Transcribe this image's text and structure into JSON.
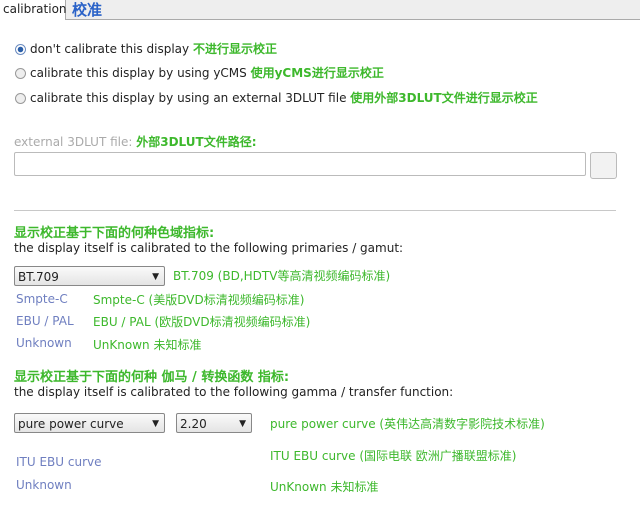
{
  "tab": {
    "label": "calibration",
    "label_cn": "校准"
  },
  "radios": [
    {
      "label": "don't calibrate this display",
      "cn": "不进行显示校正",
      "selected": true
    },
    {
      "label": "calibrate this display by using yCMS",
      "cn": "使用yCMS进行显示校正",
      "selected": false
    },
    {
      "label": "calibrate this display by using an external 3DLUT file",
      "cn": "使用外部3DLUT文件进行显示校正",
      "selected": false
    }
  ],
  "file": {
    "label": "external 3DLUT file:",
    "cn": "外部3DLUT文件路径:",
    "value": ""
  },
  "gamut": {
    "heading_cn": "显示校正基于下面的何种色域指标:",
    "desc": "the display itself is calibrated to the following primaries / gamut:",
    "selected": "BT.709",
    "selected_note": "BT.709 (BD,HDTV等高清视频编码标准)",
    "options": [
      {
        "label": "Smpte-C",
        "note": "Smpte-C (美版DVD标清视频编码标准)"
      },
      {
        "label": "EBU / PAL",
        "note": "EBU / PAL (欧版DVD标清视频编码标准)"
      },
      {
        "label": "Unknown",
        "note": "UnKnown 未知标准"
      }
    ]
  },
  "gamma": {
    "heading_cn": "显示校正基于下面的何种 伽马 / 转换函数 指标:",
    "desc": "the display itself is calibrated to the following gamma / transfer function:",
    "selected": "pure power curve",
    "value": "2.20",
    "selected_note": "pure power curve (英伟达高清数字影院技术标准)",
    "options": [
      {
        "label": "ITU EBU curve",
        "note": "ITU EBU curve (国际电联 欧洲广播联盟标准)"
      },
      {
        "label": "Unknown",
        "note": "UnKnown 未知标准"
      }
    ]
  }
}
